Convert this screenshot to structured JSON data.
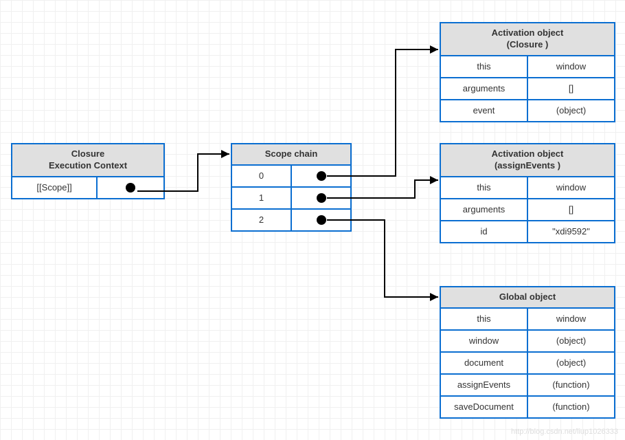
{
  "closureBox": {
    "title_line1": "Closure",
    "title_line2": "Execution Context",
    "row_label": "[[Scope]]"
  },
  "scopeChain": {
    "title": "Scope chain",
    "indices": [
      "0",
      "1",
      "2"
    ]
  },
  "activationClosure": {
    "title_line1": "Activation object",
    "title_line2": "(Closure )",
    "rows": [
      {
        "key": "this",
        "value": "window"
      },
      {
        "key": "arguments",
        "value": "[]"
      },
      {
        "key": "event",
        "value": "(object)"
      }
    ]
  },
  "activationAssign": {
    "title_line1": "Activation object",
    "title_line2": "(assignEvents )",
    "rows": [
      {
        "key": "this",
        "value": "window"
      },
      {
        "key": "arguments",
        "value": "[]"
      },
      {
        "key": "id",
        "value": "\"xdi9592\""
      }
    ]
  },
  "globalObject": {
    "title": "Global object",
    "rows": [
      {
        "key": "this",
        "value": "window"
      },
      {
        "key": "window",
        "value": "(object)"
      },
      {
        "key": "document",
        "value": "(object)"
      },
      {
        "key": "assignEvents",
        "value": "(function)"
      },
      {
        "key": "saveDocument",
        "value": "(function)"
      }
    ]
  },
  "watermark": "http://blog.csdn.net/liup1026333"
}
